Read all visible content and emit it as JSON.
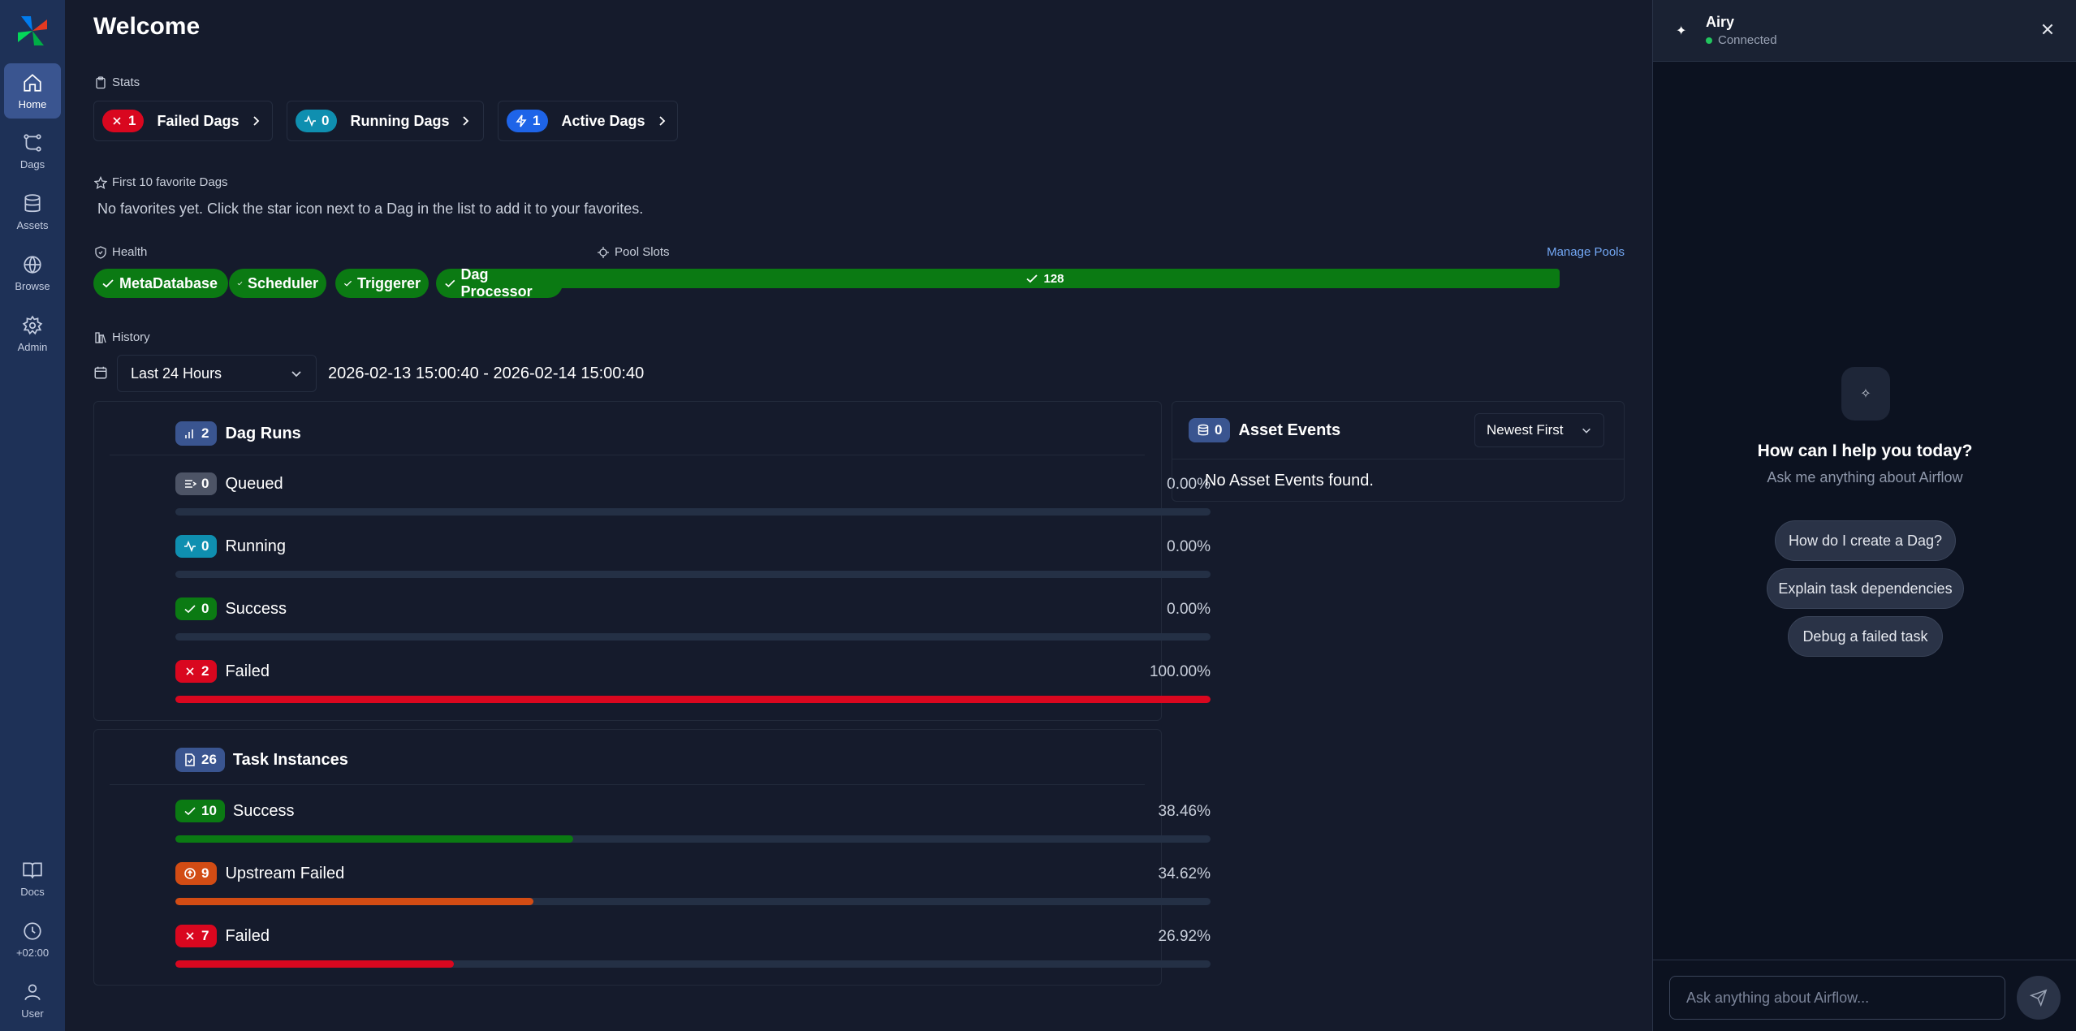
{
  "nav": {
    "items": [
      {
        "label": "Home",
        "icon": "home-icon"
      },
      {
        "label": "Dags",
        "icon": "dags-icon"
      },
      {
        "label": "Assets",
        "icon": "database-icon"
      },
      {
        "label": "Browse",
        "icon": "globe-icon"
      },
      {
        "label": "Admin",
        "icon": "gear-icon"
      }
    ],
    "bottom": [
      {
        "label": "Docs",
        "icon": "book-icon"
      },
      {
        "label": "+02:00",
        "icon": "clock-icon"
      },
      {
        "label": "User",
        "icon": "user-icon"
      }
    ]
  },
  "main": {
    "title": "Welcome",
    "stats": {
      "label": "Stats",
      "items": [
        {
          "count": "1",
          "label": "Failed Dags",
          "color": "#d9071f"
        },
        {
          "count": "0",
          "label": "Running Dags",
          "color": "#0f8fb0"
        },
        {
          "count": "1",
          "label": "Active Dags",
          "color": "#1e64e8"
        }
      ]
    },
    "favorites": {
      "label": "First 10 favorite Dags",
      "empty_text": "No favorites yet. Click the star icon next to a Dag in the list to add it to your favorites."
    },
    "health": {
      "label": "Health",
      "items": [
        "MetaDatabase",
        "Scheduler",
        "Triggerer",
        "Dag Processor"
      ]
    },
    "pool": {
      "label": "Pool Slots",
      "manage_link": "Manage Pools",
      "value": "128"
    },
    "history": {
      "label": "History",
      "range_select": "Last 24 Hours",
      "range_text": "2026-02-13 15:00:40 - 2026-02-14 15:00:40"
    },
    "dag_runs": {
      "count": "2",
      "title": "Dag Runs",
      "rows": [
        {
          "count": "0",
          "label": "Queued",
          "pct": "0.00%",
          "fraction": 0,
          "color": "#4d5466"
        },
        {
          "count": "0",
          "label": "Running",
          "pct": "0.00%",
          "fraction": 0,
          "color": "#0f8fb0"
        },
        {
          "count": "0",
          "label": "Success",
          "pct": "0.00%",
          "fraction": 0,
          "color": "#0b7a13"
        },
        {
          "count": "2",
          "label": "Failed",
          "pct": "100.00%",
          "fraction": 1.0,
          "color": "#d9071f"
        }
      ]
    },
    "task_instances": {
      "count": "26",
      "title": "Task Instances",
      "rows": [
        {
          "count": "10",
          "label": "Success",
          "pct": "38.46%",
          "fraction": 0.3846,
          "color": "#0b7a13"
        },
        {
          "count": "9",
          "label": "Upstream Failed",
          "pct": "34.62%",
          "fraction": 0.3462,
          "color": "#d24c14"
        },
        {
          "count": "7",
          "label": "Failed",
          "pct": "26.92%",
          "fraction": 0.2692,
          "color": "#d9071f"
        }
      ]
    },
    "asset_events": {
      "count": "0",
      "title": "Asset Events",
      "sort": "Newest First",
      "empty_text": "No Asset Events found."
    }
  },
  "chat": {
    "name": "Airy",
    "status": "Connected",
    "prompt_title": "How can I help you today?",
    "prompt_subtitle": "Ask me anything about Airflow",
    "suggestions": [
      "How do I create a Dag?",
      "Explain task dependencies",
      "Debug a failed task"
    ],
    "input_placeholder": "Ask anything about Airflow..."
  }
}
